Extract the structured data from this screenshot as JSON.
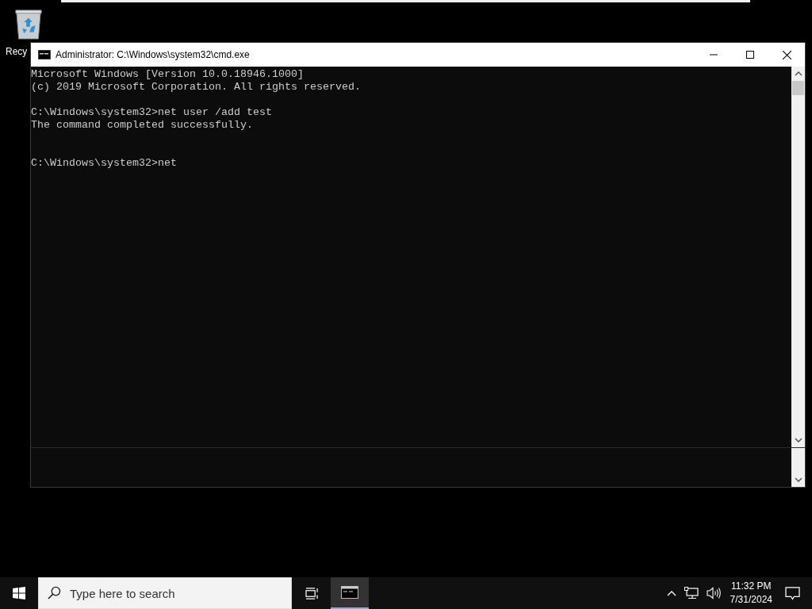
{
  "desktop_icons": [
    {
      "label": "Recy"
    }
  ],
  "window": {
    "title": "Administrator: C:\\Windows\\system32\\cmd.exe",
    "console_lines": [
      {
        "kind": "text",
        "text": "Microsoft Windows [Version 10.0.18946.1000]"
      },
      {
        "kind": "text",
        "text": "(c) 2019 Microsoft Corporation. All rights reserved."
      },
      {
        "kind": "blank"
      },
      {
        "kind": "text",
        "text": "C:\\Windows\\system32>net user /add test"
      },
      {
        "kind": "text",
        "text": "The command completed successfully."
      },
      {
        "kind": "blank"
      },
      {
        "kind": "blank"
      },
      {
        "kind": "text",
        "text": "C:\\Windows\\system32>net"
      }
    ]
  },
  "taskbar": {
    "search": {
      "placeholder": "Type here to search"
    },
    "apps": [
      {
        "selected": true
      }
    ],
    "clock": {
      "time": "11:32 PM",
      "date": "7/31/2024"
    }
  }
}
